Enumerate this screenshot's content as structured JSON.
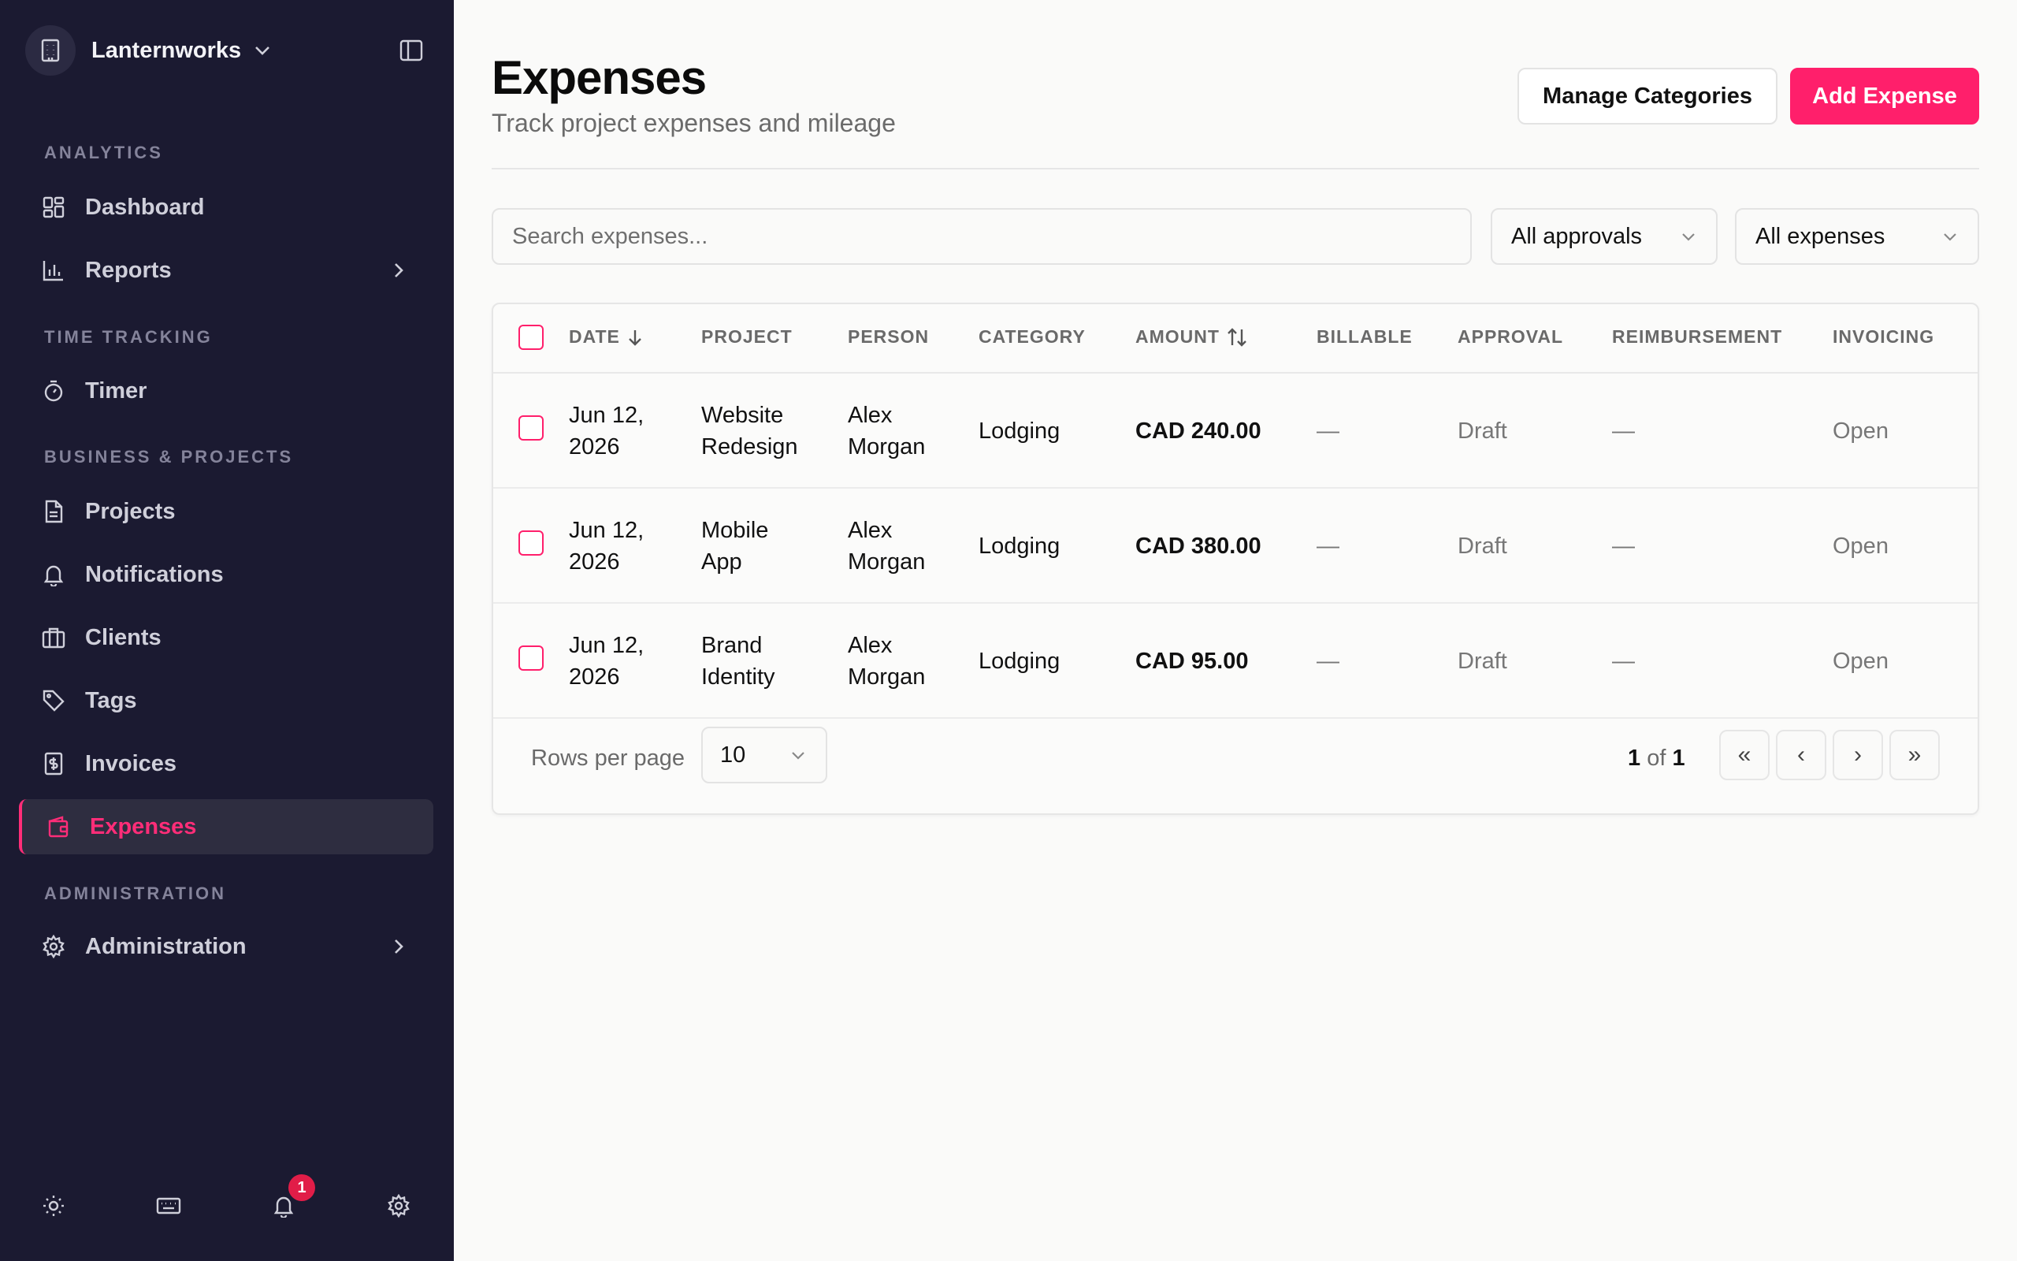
{
  "app": {
    "workspace_name": "Lanternworks"
  },
  "sidebar": {
    "sections": {
      "analytics": "ANALYTICS",
      "time_tracking": "TIME TRACKING",
      "business": "BUSINESS & PROJECTS",
      "administration": "ADMINISTRATION"
    },
    "items": {
      "dashboard": "Dashboard",
      "reports": "Reports",
      "timer": "Timer",
      "projects": "Projects",
      "notifications": "Notifications",
      "clients": "Clients",
      "tags": "Tags",
      "invoices": "Invoices",
      "expenses": "Expenses",
      "administration": "Administration"
    },
    "active_item": "expenses",
    "notification_count": "1"
  },
  "page": {
    "title": "Expenses",
    "subtitle": "Track project expenses and mileage",
    "manage_categories_label": "Manage Categories",
    "add_expense_label": "Add Expense"
  },
  "filters": {
    "search_placeholder": "Search expenses...",
    "approvals_value": "All approvals",
    "expenses_value": "All expenses"
  },
  "table": {
    "columns": {
      "date": "DATE",
      "project": "PROJECT",
      "person": "PERSON",
      "category": "CATEGORY",
      "amount": "AMOUNT",
      "billable": "BILLABLE",
      "approval": "APPROVAL",
      "reimbursement": "REIMBURSEMENT",
      "invoicing": "INVOICING"
    },
    "rows": [
      {
        "date_line1": "Jun 12,",
        "date_line2": "2026",
        "project_line1": "Website",
        "project_line2": "Redesign",
        "person_line1": "Alex",
        "person_line2": "Morgan",
        "category": "Lodging",
        "amount": "CAD 240.00",
        "billable": "—",
        "approval": "Draft",
        "reimbursement": "—",
        "invoicing": "Open"
      },
      {
        "date_line1": "Jun 12,",
        "date_line2": "2026",
        "project_line1": "Mobile",
        "project_line2": "App",
        "person_line1": "Alex",
        "person_line2": "Morgan",
        "category": "Lodging",
        "amount": "CAD 380.00",
        "billable": "—",
        "approval": "Draft",
        "reimbursement": "—",
        "invoicing": "Open"
      },
      {
        "date_line1": "Jun 12,",
        "date_line2": "2026",
        "project_line1": "Brand",
        "project_line2": "Identity",
        "person_line1": "Alex",
        "person_line2": "Morgan",
        "category": "Lodging",
        "amount": "CAD 95.00",
        "billable": "—",
        "approval": "Draft",
        "reimbursement": "—",
        "invoicing": "Open"
      }
    ],
    "footer": {
      "rows_per_page_label": "Rows per page",
      "rows_per_page_value": "10",
      "page_current": "1",
      "page_of": "of",
      "page_total": "1",
      "first_label": "«",
      "prev_label": "‹",
      "next_label": "›",
      "last_label": "»"
    }
  },
  "colors": {
    "sidebar_bg": "#1b1a31",
    "accent": "#ff1f6b",
    "page_bg": "#fafaf9",
    "badge": "#e11d48"
  }
}
